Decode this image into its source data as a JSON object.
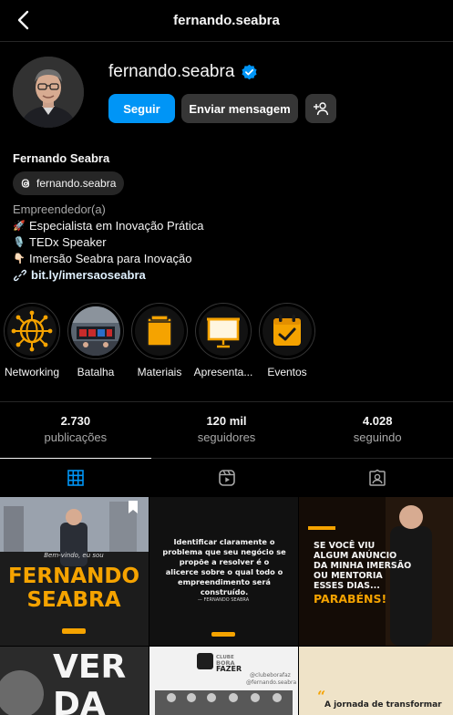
{
  "header": {
    "title": "fernando.seabra"
  },
  "profile": {
    "username": "fernando.seabra",
    "follow_label": "Seguir",
    "message_label": "Enviar mensagem",
    "full_name": "Fernando Seabra",
    "threads_handle": "fernando.seabra",
    "category": "Empreendedor(a)",
    "bio_lines": [
      {
        "emoji": "🚀",
        "text": "Especialista em Inovação Prática"
      },
      {
        "emoji": "🎙️",
        "text": "TEDx Speaker"
      },
      {
        "emoji": "👇🏻",
        "text": "Imersão Seabra para Inovação"
      }
    ],
    "link": "bit.ly/imersaoseabra"
  },
  "highlights": [
    {
      "label": "Networking",
      "icon": "globe-network-icon"
    },
    {
      "label": "Batalha",
      "icon": "photo-thumbnail"
    },
    {
      "label": "Materiais",
      "icon": "folder-icon"
    },
    {
      "label": "Apresenta...",
      "icon": "presentation-board-icon"
    },
    {
      "label": "Eventos",
      "icon": "calendar-check-icon"
    }
  ],
  "stats": [
    {
      "value": "2.730",
      "label": "publicações"
    },
    {
      "value": "120 mil",
      "label": "seguidores"
    },
    {
      "value": "4.028",
      "label": "seguindo"
    }
  ],
  "tabs": [
    {
      "name": "posts",
      "icon": "grid-icon",
      "active": true
    },
    {
      "name": "reels",
      "icon": "reels-icon",
      "active": false
    },
    {
      "name": "tagged",
      "icon": "tagged-icon",
      "active": false
    }
  ],
  "posts": [
    {
      "small": "Bem-vindo, eu sou",
      "line1": "FERNANDO",
      "line2": "SEABRA"
    },
    {
      "quote": "Identificar claramente o problema que seu negócio se propõe a resolver é o alicerce sobre o qual todo o empreendimento será construído.",
      "sig": "— FERNANDO SEABRA"
    },
    {
      "line1": "SE VOCÊ VIU",
      "line2": "ALGUM ANÚNCIO",
      "line3": "DA MINHA IMERSÃO",
      "line4": "OU MENTORIA",
      "line5": "ESSES DIAS...",
      "highlight": "PARABÉNS!"
    },
    {
      "line1": "VER",
      "line2": "DA"
    },
    {
      "brand1": "CLUBE",
      "brand2": "BORA",
      "brand3": "FAZER",
      "handle1": "@clubeborafaz",
      "handle2": "@fernando.seabra"
    },
    {
      "caption": "A jornada de transformar"
    }
  ],
  "colors": {
    "accent": "#0095f6",
    "brand_yellow": "#f5a300",
    "background": "#000000"
  }
}
